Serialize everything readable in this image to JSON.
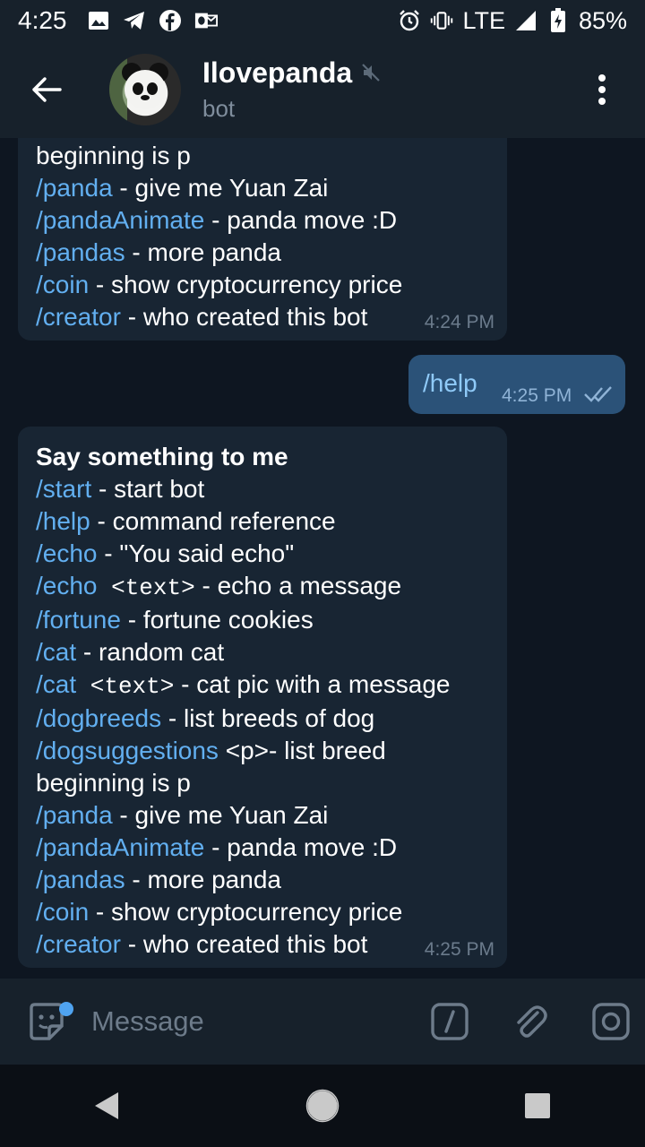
{
  "status": {
    "time": "4:25",
    "network": "LTE",
    "battery": "85%"
  },
  "header": {
    "title": "Ilovepanda",
    "subtitle": "bot"
  },
  "messages": {
    "first": {
      "lines": [
        {
          "cmd": "",
          "rest": "beginning is p"
        },
        {
          "cmd": "/panda",
          "rest": " - give me Yuan Zai"
        },
        {
          "cmd": "/pandaAnimate",
          "rest": " - panda move :D"
        },
        {
          "cmd": "/pandas",
          "rest": " - more panda"
        },
        {
          "cmd": "/coin",
          "rest": " - show cryptocurrency price"
        },
        {
          "cmd": "/creator",
          "rest": " - who created this bot"
        }
      ],
      "time": "4:24 PM"
    },
    "outgoing": {
      "text": "/help",
      "time": "4:25 PM"
    },
    "reply": {
      "heading": "Say something to me",
      "l1_cmd": "/start",
      "l1_rest": " - start bot",
      "l2_cmd": "/help",
      "l2_rest": " - command reference",
      "l3_cmd": "/echo",
      "l3_rest": " - \"You said echo\"",
      "l4_cmd": "/echo",
      "l4_mono": " <text>",
      "l4_rest": " - echo a message",
      "l5_cmd": "/fortune",
      "l5_rest": " - fortune cookies",
      "l6_cmd": "/cat",
      "l6_rest": " - random cat",
      "l7_cmd": "/cat",
      "l7_mono": " <text>",
      "l7_rest": " - cat pic with a message",
      "l8_cmd": "/dogbreeds",
      "l8_rest": " - list breeds of dog",
      "l9_cmd": "/dogsuggestions",
      "l9_rest": " <p>- list breed",
      "l10_rest": "beginning is p",
      "l11_cmd": "/panda",
      "l11_rest": " - give me Yuan Zai",
      "l12_cmd": "/pandaAnimate",
      "l12_rest": " - panda move :D",
      "l13_cmd": "/pandas",
      "l13_rest": " - more panda",
      "l14_cmd": "/coin",
      "l14_rest": " - show cryptocurrency price",
      "l15_cmd": "/creator",
      "l15_rest": " - who created this bot",
      "time": "4:25 PM"
    }
  },
  "input": {
    "placeholder": "Message"
  },
  "icons": {
    "link_color": "#62aff0",
    "accent": "#4fa3f0"
  }
}
